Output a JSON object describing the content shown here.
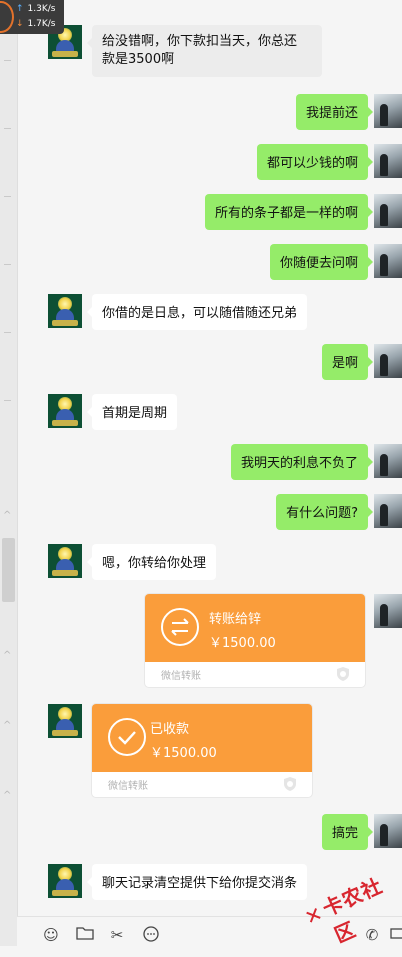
{
  "network": {
    "upload": "1.3K/s",
    "download": "1.7K/s"
  },
  "messages": {
    "m1": "给没错啊，你下款扣当天，你总还",
    "m1b": "款是3500啊",
    "m2": "我提前还",
    "m3": "都可以少钱的啊",
    "m4": "所有的条子都是一样的啊",
    "m5": "你随便去问啊",
    "m6": "你借的是日息，可以随借随还兄弟",
    "m7": "是啊",
    "m8": "首期是周期",
    "m9": "我明天的利息不负了",
    "m10": "有什么问题?",
    "m11": "嗯，你转给你处理",
    "m12": "搞完",
    "m13": "聊天记录清空提供下给你提交消条"
  },
  "transfer_sent": {
    "title": "转账给锌",
    "amount": "￥1500.00",
    "footer": "微信转账"
  },
  "transfer_received": {
    "title": "已收款",
    "amount": "￥1500.00",
    "footer": "微信转账"
  },
  "toolbar": {
    "icons": [
      "emoji-icon",
      "folder-icon",
      "scissors-icon",
      "chat-icon",
      "phone-icon",
      "video-icon"
    ]
  },
  "watermark": {
    "text": "卡农社区"
  },
  "colors": {
    "my_bubble": "#95ec69",
    "transfer": "#fa9d3b",
    "bg": "#f5f5f5"
  }
}
